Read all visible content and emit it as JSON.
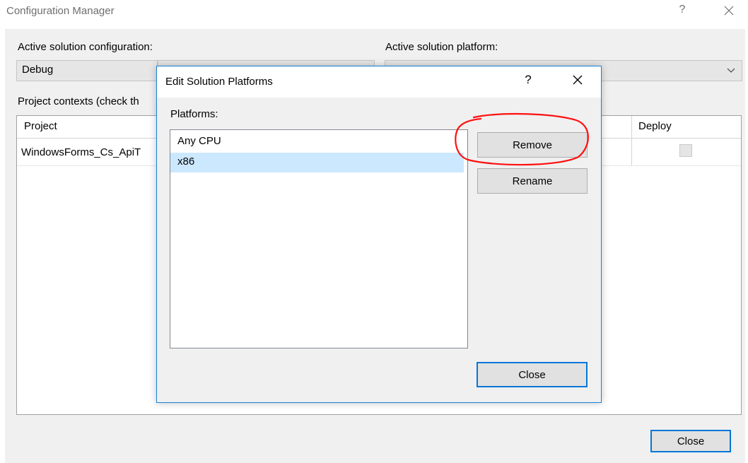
{
  "outer_window": {
    "title": "Configuration Manager",
    "help_symbol": "?",
    "close_icon": "close-icon",
    "active_configuration_label": "Active solution configuration:",
    "active_configuration_value": "Debug",
    "active_platform_label": "Active solution platform:",
    "active_platform_value": "",
    "project_contexts_label": "Project contexts (check th",
    "grid": {
      "headers": [
        "Project",
        "Deploy"
      ],
      "rows": [
        {
          "project": "WindowsForms_Cs_ApiT",
          "deploy_checked": false
        }
      ]
    },
    "close_button_label": "Close"
  },
  "dialog": {
    "title": "Edit Solution Platforms",
    "help_symbol": "?",
    "close_icon": "close-icon",
    "platforms_label": "Platforms:",
    "platforms": [
      "Any CPU",
      "x86"
    ],
    "selected_platform": "x86",
    "remove_button_label": "Remove",
    "rename_button_label": "Rename",
    "close_button_label": "Close"
  },
  "annotation": {
    "type": "red-hand-drawn-circle",
    "color": "#ff0000",
    "target": "Remove"
  },
  "colors": {
    "accent": "#0078d7",
    "selection": "#cce8ff",
    "dialog_border": "#1883d7"
  }
}
